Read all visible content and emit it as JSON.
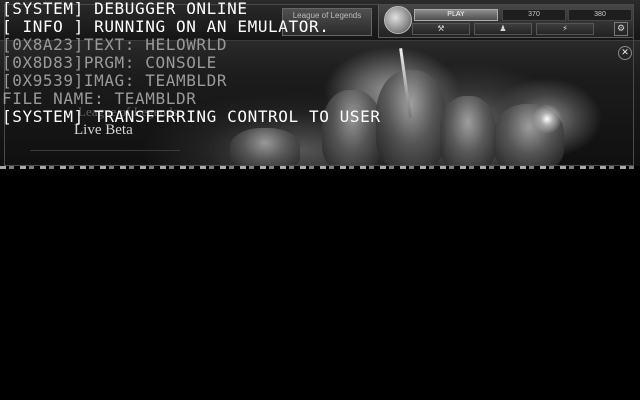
{
  "client": {
    "banner_title": "Live Beta",
    "banner_subtitle": "League of Legends",
    "logo_text": "League of Legends",
    "play_button": "PLAY",
    "ip_value": "370",
    "rp_value": "380",
    "nav_tabs": [
      "⚒",
      "♟",
      "⚡"
    ],
    "settings_icon": "⚙",
    "close_icon": "✕"
  },
  "console": {
    "lines": [
      {
        "text": "[SYSTEM] DEBUGGER ONLINE",
        "style": "bright"
      },
      {
        "text": "[ INFO ] RUNNING ON AN EMULATOR.",
        "style": "bright"
      },
      {
        "text": "[0X8A23]TEXT: HELOWRLD",
        "style": "dim"
      },
      {
        "text": "[0X8D83]PRGM: CONSOLE",
        "style": "dim"
      },
      {
        "text": "[0X9539]IMAG: TEAMBLDR",
        "style": "dim"
      },
      {
        "text": "FILE NAME: TEAMBLDR",
        "style": "dim"
      },
      {
        "text": "[SYSTEM] TRANSFERRING CONTROL TO USER",
        "style": "bright"
      }
    ]
  },
  "colors": {
    "background": "#000000",
    "console_bright": "#ffffff",
    "console_dim": "#9a9a9a"
  }
}
